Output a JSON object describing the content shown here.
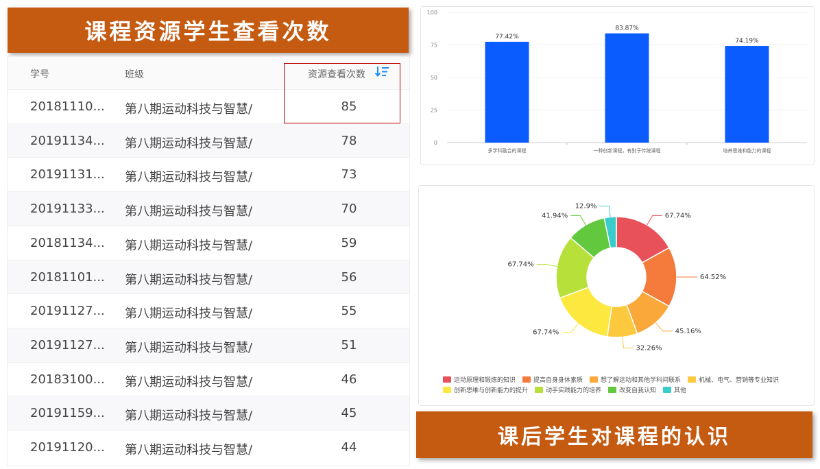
{
  "banners": {
    "left": "课程资源学生查看次数",
    "right": "课后学生对课程的认识"
  },
  "table": {
    "headers": [
      "学号",
      "班级",
      "资源查看次数"
    ],
    "sort_icon": "sort-descending-icon",
    "rows": [
      {
        "id": "20181110...",
        "cls": "第八期运动科技与智慧/",
        "views": "85"
      },
      {
        "id": "20191134...",
        "cls": "第八期运动科技与智慧/",
        "views": "78"
      },
      {
        "id": "20191131...",
        "cls": "第八期运动科技与智慧/",
        "views": "73"
      },
      {
        "id": "20191133...",
        "cls": "第八期运动科技与智慧/",
        "views": "70"
      },
      {
        "id": "20181134...",
        "cls": "第八期运动科技与智慧/",
        "views": "59"
      },
      {
        "id": "20181101...",
        "cls": "第八期运动科技与智慧/",
        "views": "56"
      },
      {
        "id": "20191127...",
        "cls": "第八期运动科技与智慧/",
        "views": "55"
      },
      {
        "id": "20191127...",
        "cls": "第八期运动科技与智慧/",
        "views": "51"
      },
      {
        "id": "20183100...",
        "cls": "第八期运动科技与智慧/",
        "views": "46"
      },
      {
        "id": "20191159...",
        "cls": "第八期运动科技与智慧/",
        "views": "45"
      },
      {
        "id": "20191120...",
        "cls": "第八期运动科技与智慧/",
        "views": "44"
      }
    ]
  },
  "colors": {
    "banner": "#c55a11",
    "bar": "#0a5cff",
    "highlight": "#c00000",
    "sort_icon": "#1890ff"
  },
  "chart_data": [
    {
      "type": "bar",
      "categories": [
        "多学科融合的课程",
        "一种创新课程，有别于传统课程",
        "培养思维和能力的课程"
      ],
      "values": [
        77.42,
        83.87,
        74.19
      ],
      "data_labels": [
        "77.42%",
        "83.87%",
        "74.19%"
      ],
      "ylim": [
        0,
        100
      ],
      "yticks": [
        0,
        25,
        50,
        75,
        100
      ],
      "color": "#0a5cff"
    },
    {
      "type": "pie",
      "variant": "donut",
      "legend_position": "bottom",
      "series": [
        {
          "name": "运动原理和锻炼的知识",
          "value": 67.74,
          "label": "67.74%",
          "color": "#e8515a"
        },
        {
          "name": "提高自身身体素质",
          "value": 64.52,
          "label": "64.52%",
          "color": "#f47b3c"
        },
        {
          "name": "想了解运动和其他学科间联系",
          "value": 45.16,
          "label": "45.16%",
          "color": "#fba83a"
        },
        {
          "name": "机械、电气、营销等专业知识",
          "value": 32.26,
          "label": "32.26%",
          "color": "#fcc93e"
        },
        {
          "name": "创新思维与创新能力的提升",
          "value": 67.74,
          "label": "67.74%",
          "color": "#fce83f"
        },
        {
          "name": "动手实践能力的培养",
          "value": 67.74,
          "label": "67.74%",
          "color": "#b8e03a"
        },
        {
          "name": "改变自我认知",
          "value": 41.94,
          "label": "41.94%",
          "color": "#62c93f"
        },
        {
          "name": "其他",
          "value": 12.9,
          "label": "12.9%",
          "color": "#3acccb"
        }
      ]
    }
  ]
}
